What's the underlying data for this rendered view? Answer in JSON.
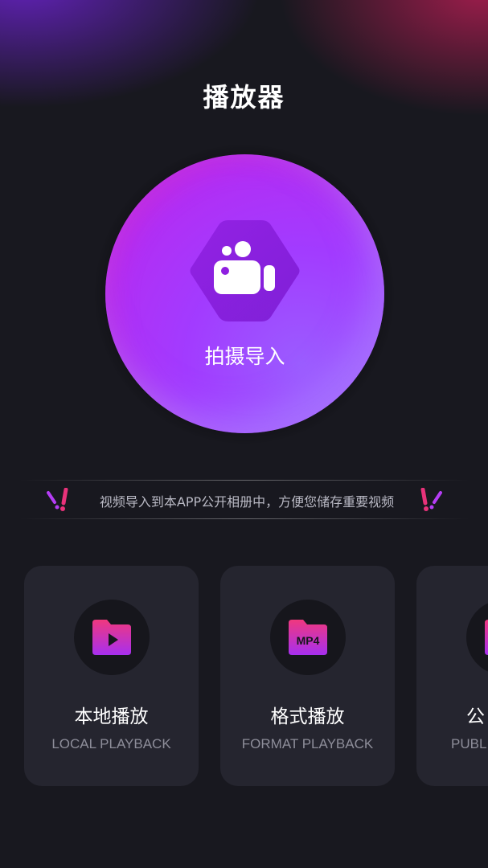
{
  "header": {
    "title": "播放器"
  },
  "hero": {
    "label": "拍摄导入",
    "icon": "video-camera-icon"
  },
  "notice": {
    "text": "视频导入到本APP公开相册中，方便您储存重要视频"
  },
  "cards": [
    {
      "title": "本地播放",
      "subtitle": "LOCAL PLAYBACK",
      "icon": "folder-play-icon"
    },
    {
      "title": "格式播放",
      "subtitle": "FORMAT PLAYBACK",
      "icon": "folder-mp4-icon",
      "icon_text": "MP4"
    },
    {
      "title": "公",
      "subtitle": "PUBL",
      "icon": "folder-icon"
    }
  ],
  "colors": {
    "background": "#18181f",
    "card_background": "#25252f",
    "accent_purple": "#a23bff",
    "accent_pink": "#e8327a"
  }
}
